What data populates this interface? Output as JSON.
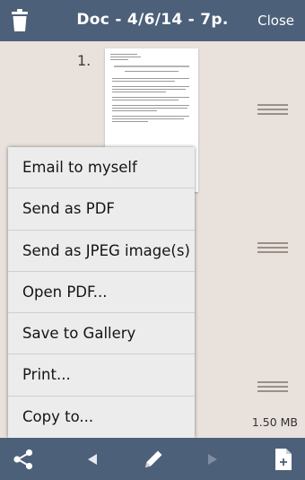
{
  "header": {
    "title": "Doc - 4/6/14 - 7p.",
    "close_label": "Close"
  },
  "document": {
    "page_number": "1.",
    "file_size": "1.50 MB"
  },
  "menu": {
    "items": [
      {
        "label": "Email to myself"
      },
      {
        "label": "Send as PDF"
      },
      {
        "label": "Send as JPEG image(s)"
      },
      {
        "label": "Open PDF..."
      },
      {
        "label": "Save to Gallery"
      },
      {
        "label": "Print..."
      },
      {
        "label": "Copy to..."
      }
    ]
  },
  "toolbar": {
    "icons": [
      "share-icon",
      "previous-icon",
      "pencil-icon",
      "next-icon",
      "add-page-icon"
    ]
  },
  "colors": {
    "bar": "#4d6079",
    "background": "#e8e1dc",
    "menu": "#ececec"
  }
}
